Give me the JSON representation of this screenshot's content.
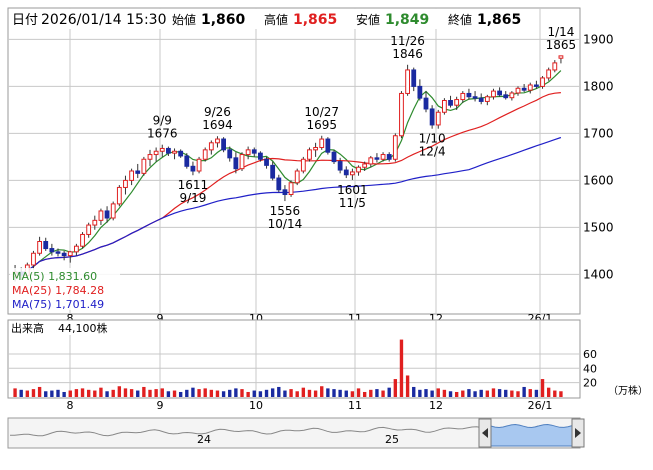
{
  "header": {
    "date_label": "日付",
    "datetime": "2026/01/14 15:30",
    "open_label": "始値",
    "open": "1,860",
    "high_label": "高値",
    "high": "1,865",
    "low_label": "安値",
    "low": "1,849",
    "close_label": "終値",
    "close": "1,865"
  },
  "colors": {
    "up": "#e02020",
    "down": "#1a2aa0",
    "ma5": "#2e8b2e",
    "ma25": "#e02020",
    "ma75": "#2020c8",
    "grid": "#c8c8c8",
    "volume_up": "#e02020",
    "volume_down": "#1a2aa0",
    "navigator_fill": "#a8c8f0"
  },
  "chart_data": [
    {
      "type": "candlestick",
      "x_tick_labels": [
        "8",
        "9",
        "10",
        "11",
        "12",
        "26/1"
      ],
      "ylim": [
        1320,
        1920
      ],
      "yticks": [
        1400,
        1500,
        1600,
        1700,
        1800,
        1900
      ],
      "grid": true,
      "legend": [
        {
          "name": "MA(5)",
          "value": "1,831.60"
        },
        {
          "name": "MA(25)",
          "value": "1,784.28"
        },
        {
          "name": "MA(75)",
          "value": "1,701.49"
        }
      ],
      "annotations": [
        {
          "date": "9/9",
          "value": 1676,
          "text": [
            "9/9",
            "1676"
          ],
          "position": "above"
        },
        {
          "date": "9/19",
          "value": 1611,
          "text": [
            "1611",
            "9/19"
          ],
          "position": "below"
        },
        {
          "date": "9/26",
          "value": 1694,
          "text": [
            "9/26",
            "1694"
          ],
          "position": "above"
        },
        {
          "date": "10/14",
          "value": 1556,
          "text": [
            "1556",
            "10/14"
          ],
          "position": "below"
        },
        {
          "date": "10/27",
          "value": 1695,
          "text": [
            "10/27",
            "1695"
          ],
          "position": "above"
        },
        {
          "date": "11/5",
          "value": 1601,
          "text": [
            "1601",
            "11/5"
          ],
          "position": "below"
        },
        {
          "date": "11/26",
          "value": 1846,
          "text": [
            "11/26",
            "1846"
          ],
          "position": "above"
        },
        {
          "date": "12/4",
          "value": 1710,
          "text": [
            "1/10",
            "12/4"
          ],
          "position": "below"
        },
        {
          "date": "1/14",
          "value": 1865,
          "text": [
            "1/14",
            "1865"
          ],
          "position": "above"
        }
      ],
      "ohlc": [
        [
          1395,
          1420,
          1385,
          1405
        ],
        [
          1405,
          1415,
          1390,
          1398
        ],
        [
          1398,
          1425,
          1395,
          1420
        ],
        [
          1420,
          1450,
          1410,
          1445
        ],
        [
          1445,
          1480,
          1440,
          1470
        ],
        [
          1470,
          1478,
          1450,
          1455
        ],
        [
          1455,
          1465,
          1440,
          1448
        ],
        [
          1448,
          1455,
          1438,
          1445
        ],
        [
          1445,
          1450,
          1430,
          1440
        ],
        [
          1440,
          1450,
          1425,
          1448
        ],
        [
          1448,
          1465,
          1440,
          1460
        ],
        [
          1460,
          1490,
          1455,
          1485
        ],
        [
          1485,
          1510,
          1478,
          1505
        ],
        [
          1505,
          1525,
          1495,
          1515
        ],
        [
          1515,
          1540,
          1505,
          1535
        ],
        [
          1535,
          1545,
          1510,
          1520
        ],
        [
          1520,
          1555,
          1515,
          1550
        ],
        [
          1550,
          1590,
          1545,
          1585
        ],
        [
          1585,
          1610,
          1570,
          1600
        ],
        [
          1600,
          1625,
          1590,
          1620
        ],
        [
          1620,
          1635,
          1605,
          1615
        ],
        [
          1615,
          1650,
          1610,
          1645
        ],
        [
          1645,
          1665,
          1630,
          1655
        ],
        [
          1655,
          1670,
          1640,
          1662
        ],
        [
          1662,
          1676,
          1650,
          1668
        ],
        [
          1668,
          1672,
          1652,
          1658
        ],
        [
          1658,
          1668,
          1645,
          1662
        ],
        [
          1662,
          1666,
          1648,
          1652
        ],
        [
          1652,
          1658,
          1625,
          1630
        ],
        [
          1630,
          1640,
          1611,
          1620
        ],
        [
          1620,
          1650,
          1615,
          1645
        ],
        [
          1645,
          1670,
          1640,
          1665
        ],
        [
          1665,
          1685,
          1655,
          1680
        ],
        [
          1680,
          1694,
          1670,
          1688
        ],
        [
          1688,
          1692,
          1660,
          1665
        ],
        [
          1665,
          1672,
          1640,
          1648
        ],
        [
          1648,
          1660,
          1615,
          1625
        ],
        [
          1625,
          1660,
          1620,
          1655
        ],
        [
          1655,
          1672,
          1645,
          1665
        ],
        [
          1665,
          1670,
          1650,
          1658
        ],
        [
          1658,
          1662,
          1640,
          1645
        ],
        [
          1645,
          1650,
          1625,
          1632
        ],
        [
          1632,
          1640,
          1600,
          1605
        ],
        [
          1605,
          1612,
          1575,
          1580
        ],
        [
          1580,
          1590,
          1556,
          1570
        ],
        [
          1570,
          1600,
          1565,
          1595
        ],
        [
          1595,
          1625,
          1590,
          1620
        ],
        [
          1620,
          1650,
          1615,
          1645
        ],
        [
          1645,
          1670,
          1640,
          1665
        ],
        [
          1665,
          1680,
          1650,
          1670
        ],
        [
          1670,
          1695,
          1665,
          1688
        ],
        [
          1688,
          1692,
          1655,
          1660
        ],
        [
          1660,
          1665,
          1635,
          1640
        ],
        [
          1640,
          1648,
          1615,
          1622
        ],
        [
          1622,
          1630,
          1605,
          1612
        ],
        [
          1612,
          1625,
          1601,
          1618
        ],
        [
          1618,
          1632,
          1610,
          1628
        ],
        [
          1628,
          1640,
          1620,
          1635
        ],
        [
          1635,
          1652,
          1628,
          1648
        ],
        [
          1648,
          1658,
          1638,
          1645
        ],
        [
          1645,
          1660,
          1640,
          1655
        ],
        [
          1655,
          1660,
          1640,
          1645
        ],
        [
          1645,
          1700,
          1640,
          1695
        ],
        [
          1695,
          1790,
          1690,
          1785
        ],
        [
          1785,
          1846,
          1780,
          1835
        ],
        [
          1835,
          1840,
          1790,
          1800
        ],
        [
          1800,
          1815,
          1770,
          1775
        ],
        [
          1775,
          1790,
          1745,
          1752
        ],
        [
          1752,
          1760,
          1710,
          1718
        ],
        [
          1718,
          1750,
          1710,
          1745
        ],
        [
          1745,
          1775,
          1740,
          1770
        ],
        [
          1770,
          1780,
          1755,
          1760
        ],
        [
          1760,
          1778,
          1750,
          1772
        ],
        [
          1772,
          1790,
          1765,
          1785
        ],
        [
          1785,
          1795,
          1772,
          1778
        ],
        [
          1778,
          1790,
          1768,
          1775
        ],
        [
          1775,
          1785,
          1762,
          1768
        ],
        [
          1768,
          1782,
          1760,
          1778
        ],
        [
          1778,
          1795,
          1772,
          1790
        ],
        [
          1790,
          1798,
          1778,
          1782
        ],
        [
          1782,
          1790,
          1772,
          1776
        ],
        [
          1776,
          1790,
          1770,
          1786
        ],
        [
          1786,
          1800,
          1780,
          1796
        ],
        [
          1796,
          1805,
          1788,
          1792
        ],
        [
          1792,
          1808,
          1785,
          1803
        ],
        [
          1803,
          1812,
          1795,
          1800
        ],
        [
          1800,
          1822,
          1795,
          1818
        ],
        [
          1818,
          1840,
          1812,
          1835
        ],
        [
          1835,
          1856,
          1830,
          1850
        ],
        [
          1860,
          1865,
          1849,
          1865
        ]
      ]
    },
    {
      "type": "bar",
      "title": "出来高",
      "latest_label": "44,100株",
      "unit": "（万株）",
      "ylim": [
        0,
        85
      ],
      "yticks": [
        20,
        40,
        60
      ],
      "volumes": [
        12,
        10,
        9,
        11,
        14,
        8,
        9,
        10,
        7,
        9,
        11,
        12,
        10,
        9,
        13,
        8,
        10,
        15,
        12,
        11,
        9,
        14,
        10,
        11,
        12,
        8,
        9,
        7,
        10,
        13,
        11,
        12,
        10,
        9,
        8,
        10,
        12,
        11,
        7,
        9,
        8,
        10,
        12,
        14,
        9,
        11,
        8,
        13,
        10,
        9,
        15,
        12,
        11,
        10,
        9,
        8,
        12,
        7,
        10,
        11,
        9,
        13,
        25,
        80,
        30,
        14,
        10,
        11,
        9,
        12,
        10,
        8,
        7,
        9,
        11,
        8,
        10,
        9,
        12,
        11,
        10,
        9,
        8,
        14,
        11,
        10,
        25,
        13,
        9,
        8
      ]
    },
    {
      "type": "area",
      "x_tick_labels": [
        "24",
        "25"
      ]
    }
  ]
}
